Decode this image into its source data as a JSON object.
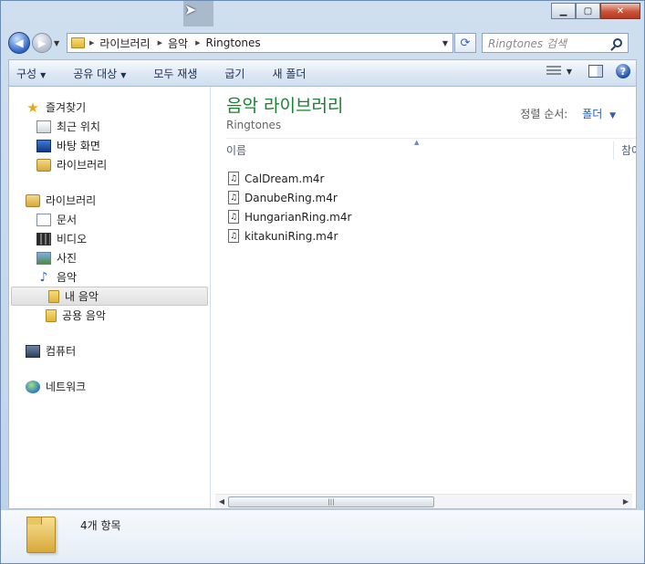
{
  "navigation": {
    "breadcrumbs": [
      "라이브러리",
      "음악",
      "Ringtones"
    ],
    "search_placeholder": "Ringtones 검색"
  },
  "toolbar": {
    "organize": "구성",
    "share_with": "공유 대상",
    "play_all": "모두 재생",
    "burn": "굽기",
    "new_folder": "새 폴더"
  },
  "sidebar": {
    "favorites": {
      "label": "즐겨찾기",
      "items": [
        "최근 위치",
        "바탕 화면",
        "라이브러리"
      ]
    },
    "libraries": {
      "label": "라이브러리",
      "items": [
        "문서",
        "비디오",
        "사진",
        "음악"
      ],
      "music_children": [
        "내 음악",
        "공용 음악"
      ]
    },
    "computer": "컴퓨터",
    "network": "네트워크"
  },
  "content": {
    "library_title": "음악 라이브러리",
    "library_subtitle": "Ringtones",
    "arrange_label": "정렬 순서:",
    "arrange_value": "폴더",
    "columns": {
      "name": "이름",
      "ref": "참여"
    },
    "files": [
      "CalDream.m4r",
      "DanubeRing.m4r",
      "HungarianRing.m4r",
      "kitakuniRing.m4r"
    ]
  },
  "status": {
    "item_count": "4개 항목"
  }
}
